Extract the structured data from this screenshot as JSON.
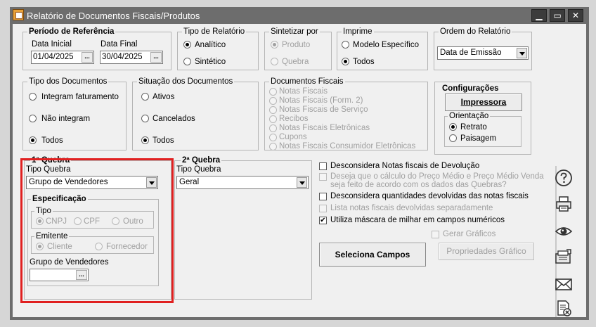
{
  "window": {
    "title": "Relatório de Documentos Fiscais/Produtos",
    "buttons": {
      "minimize": "minimize-icon",
      "maximize": "maximize-icon",
      "close": "close-icon"
    }
  },
  "periodo": {
    "title": "Período de Referência",
    "data_inicial_label": "Data Inicial",
    "data_inicial": "01/04/2025",
    "data_final_label": "Data Final",
    "data_final": "30/04/2025",
    "dots": "..."
  },
  "tipo_relatorio": {
    "title": "Tipo de Relatório",
    "opt1": "Analítico",
    "opt2": "Sintético",
    "selected": "Analítico"
  },
  "sintetizar": {
    "title": "Sintetizar por",
    "opt1": "Produto",
    "opt2": "Quebra",
    "selected": "Produto"
  },
  "imprime": {
    "title": "Imprime",
    "opt1": "Modelo Específico",
    "opt2": "Todos",
    "selected": "Todos"
  },
  "ordem": {
    "title": "Ordem do Relatório",
    "value": "Data de Emissão"
  },
  "tipo_docs": {
    "title": "Tipo dos Documentos",
    "opt1": "Integram faturamento",
    "opt2": "Não integram",
    "opt3": "Todos",
    "selected": "Todos"
  },
  "situacao": {
    "title": "Situação dos Documentos",
    "opt1": "Ativos",
    "opt2": "Cancelados",
    "opt3": "Todos",
    "selected": "Todos"
  },
  "docs_fiscais": {
    "title": "Documentos Fiscais",
    "items": [
      "Notas Fiscais",
      "Notas Fiscais (Form. 2)",
      "Notas Fiscais de Serviço",
      "Recibos",
      "Notas Fiscais Eletrônicas",
      "Cupons",
      "Notas Fiscais Consumidor Eletrônicas"
    ]
  },
  "config": {
    "title": "Configurações",
    "impressora": "Impressora",
    "orientacao_title": "Orientação",
    "retrato": "Retrato",
    "paisagem": "Paisagem",
    "selected": "Retrato"
  },
  "quebra1": {
    "title": "1ª Quebra",
    "tipo_label": "Tipo Quebra",
    "tipo_value": "Grupo de Vendedores",
    "espec_title": "Especificação",
    "tipo_title": "Tipo",
    "cnpj": "CNPJ",
    "cpf": "CPF",
    "outro": "Outro",
    "emitente_title": "Emitente",
    "cliente": "Cliente",
    "fornecedor": "Fornecedor",
    "grupo_label": "Grupo de Vendedores",
    "grupo_value": "",
    "dots": "..."
  },
  "quebra2": {
    "title": "2ª Quebra",
    "tipo_label": "Tipo Quebra",
    "tipo_value": "Geral"
  },
  "options": {
    "opt1": "Desconsidera Notas fiscais de Devolução",
    "opt2a": "Deseja que o cálculo do Preço Médio e Preço Médio Venda",
    "opt2b": "seja feito de acordo com os dados das Quebras?",
    "opt3": "Desconsidera quantidades devolvidas das notas fiscais",
    "opt4": "Lista notas fiscais devolvidas separadamente",
    "opt5": "Utiliza máscara de milhar em campos numéricos",
    "gerar_graficos": "Gerar Gráficos",
    "check_mark": "✔"
  },
  "buttons": {
    "seleciona": "Seleciona Campos",
    "propriedades": "Propriedades Gráfico"
  },
  "sidebar_icons": [
    "help-icon",
    "printer-icon",
    "preview-icon",
    "export-icon",
    "email-icon",
    "close-report-icon"
  ],
  "colors": {
    "highlight": "#e02020",
    "titlebar": "#6d6d6d"
  }
}
